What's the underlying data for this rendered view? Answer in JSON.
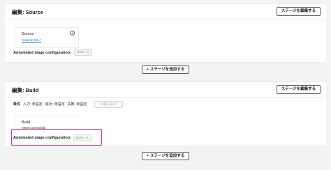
{
  "colors": {
    "background": "#f2f3f3",
    "panel": "#ffffff",
    "link": "#0073bb",
    "highlight": "#e0338a"
  },
  "stages": [
    {
      "title": "編集: Source",
      "edit_button": "ステージを編集する",
      "action": {
        "name": "Source",
        "provider": "Amazon S3",
        "provider_icon": "external-link-icon",
        "info_icon": "info-icon"
      },
      "auto_config_label": "Automated stage configuration:",
      "auto_config_value": "None"
    },
    {
      "title": "編集: Build",
      "edit_button": "ステージを編集する",
      "conditions": {
        "label": "条件",
        "entry": "入力: 未設定",
        "success": "成功: 未設定",
        "failure": "失敗: 未設定",
        "details_button": "詳細を表示"
      },
      "action": {
        "name": "Build",
        "provider": "AWS Commands"
      },
      "auto_config_label": "Automated stage configuration:",
      "auto_config_value": "None",
      "highlighted": true
    }
  ],
  "add_stage_label": "ステージを追加する",
  "add_stage_icon": "plus-icon",
  "select_icon": "chevron-down-icon"
}
